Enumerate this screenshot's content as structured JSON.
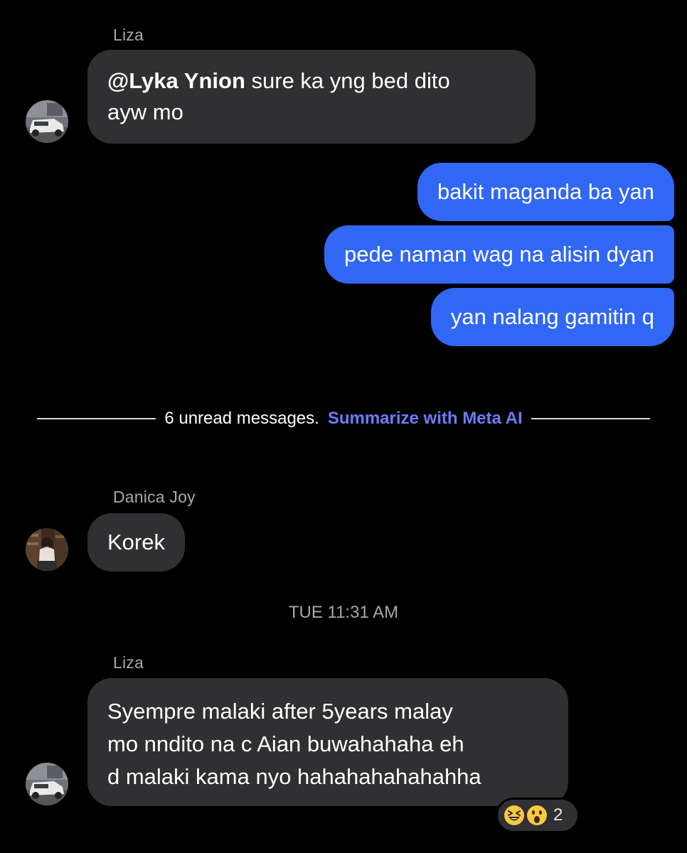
{
  "messages": [
    {
      "sender": "Liza",
      "mention": "@Lyka Ynion",
      "text_line1": " sure ka yng bed dito",
      "text_line2": "ayw mo"
    },
    {
      "outgoing": [
        "bakit maganda ba yan",
        "pede naman wag na alisin dyan",
        "yan nalang gamitin q"
      ]
    },
    {
      "sender": "Danica Joy",
      "text": "Korek"
    },
    {
      "sender": "Liza",
      "lines": [
        "Syempre malaki after 5years malay",
        "mo nndito na c Aian buwahahaha eh",
        "d malaki kama nyo hahahahahahahha"
      ],
      "reactions": {
        "emojis": [
          "laughing-squint-emoji",
          "surprised-face-emoji"
        ],
        "count": "2"
      }
    }
  ],
  "divider": {
    "unread_text": "6 unread messages.",
    "summarize_link": "Summarize with Meta AI"
  },
  "timestamp": "TUE 11:31 AM",
  "colors": {
    "background": "#000000",
    "incoming_bubble": "#303033",
    "outgoing_bubble": "#3167f5",
    "link": "#6b7cf6",
    "muted_text": "#a8a8ad"
  }
}
